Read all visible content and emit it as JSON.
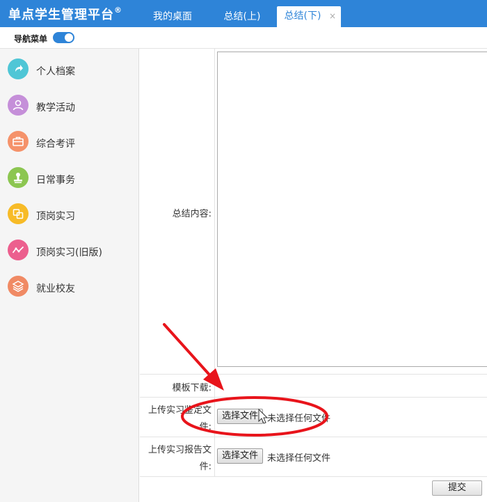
{
  "app": {
    "title": "单点学生管理平台",
    "reg_mark": "®"
  },
  "tabs": [
    {
      "label": "我的桌面"
    },
    {
      "label": "总结(上)"
    },
    {
      "label": "总结(下)",
      "close": "×"
    }
  ],
  "nav": {
    "label": "导航菜单",
    "toggle_on": true
  },
  "sidebar": {
    "items": [
      {
        "label": "个人档案",
        "icon": "share-arrow-icon",
        "color": "#4fc6d6"
      },
      {
        "label": "教学活动",
        "icon": "user-icon",
        "color": "#c58fd9"
      },
      {
        "label": "综合考评",
        "icon": "briefcase-icon",
        "color": "#f5926a"
      },
      {
        "label": "日常事务",
        "icon": "stamp-icon",
        "color": "#8cc651"
      },
      {
        "label": "顶岗实习",
        "icon": "exchange-icon",
        "color": "#f7bb27"
      },
      {
        "label": "顶岗实习(旧版)",
        "icon": "trend-icon",
        "color": "#ec5f8e"
      },
      {
        "label": "就业校友",
        "icon": "layers-icon",
        "color": "#f08a64"
      }
    ]
  },
  "form": {
    "summary_label": "总结内容:",
    "template_label": "模板下载:",
    "upload_appraisal_label_1": "上传实习鉴定文",
    "upload_appraisal_label_2": "件:",
    "upload_report_label_1": "上传实习报告文",
    "upload_report_label_2": "件:",
    "choose_file": "选择文件",
    "no_file": "未选择任何文件",
    "submit": "提交"
  },
  "colors": {
    "brand": "#2e84d8",
    "annotation": "#e8141b"
  }
}
